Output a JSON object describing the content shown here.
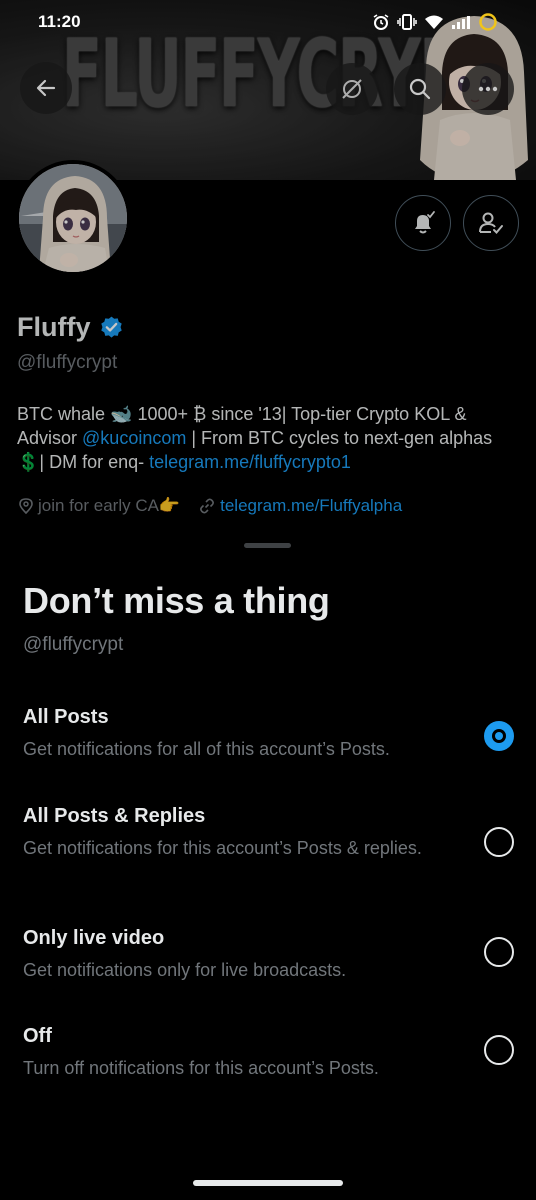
{
  "status_bar": {
    "time": "11:20"
  },
  "banner": {
    "text": "FLUFFYCRYPT"
  },
  "profile": {
    "name": "Fluffy",
    "handle": "@fluffycrypt",
    "bio": {
      "part1": "BTC whale 🐋 1000+ ₿ since '13| Top-tier Crypto KOL & Advisor ",
      "mention": "@kucoincom",
      "part2": " | From BTC cycles to next-gen alphas 💲| DM for enq- ",
      "bio_link": "telegram.me/fluffycrypto1"
    },
    "location": "join for early CA👉",
    "website": "telegram.me/Fluffyalpha"
  },
  "sheet": {
    "title": "Don’t miss a thing",
    "handle": "@fluffycrypt",
    "options": [
      {
        "title": "All Posts",
        "description": "Get notifications for all of this account’s Posts.",
        "selected": true
      },
      {
        "title": "All Posts & Replies",
        "description": "Get notifications for this account’s Posts & replies.",
        "selected": false
      },
      {
        "title": "Only live video",
        "description": "Get notifications only for live broadcasts.",
        "selected": false
      },
      {
        "title": "Off",
        "description": "Turn off notifications for this account’s Posts.",
        "selected": false
      }
    ]
  },
  "colors": {
    "accent": "#1d9bf0",
    "background": "#000000",
    "secondary_text": "#71767b"
  },
  "icons": [
    "back-arrow-icon",
    "no-sync-icon",
    "search-icon",
    "more-icon",
    "bell-check-icon",
    "user-check-icon",
    "verified-badge-icon",
    "location-icon",
    "link-icon"
  ]
}
